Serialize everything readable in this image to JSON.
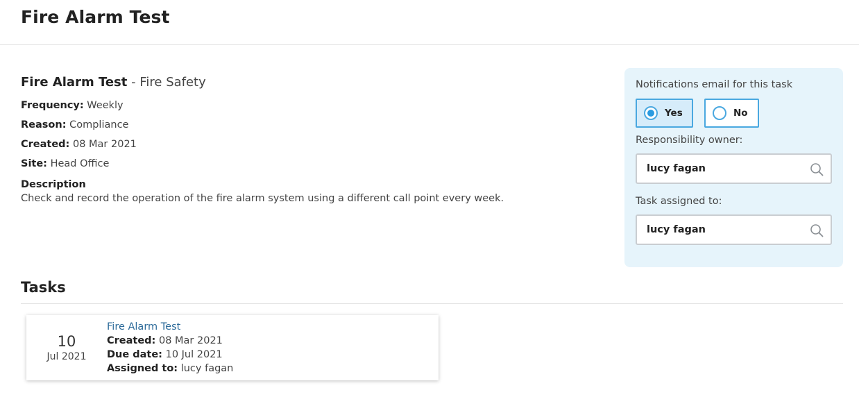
{
  "header": {
    "title": "Fire Alarm Test"
  },
  "details": {
    "name": "Fire Alarm Test",
    "separator": " - ",
    "category": "Fire Safety",
    "frequency_label": "Frequency:",
    "frequency": "Weekly",
    "reason_label": "Reason:",
    "reason": "Compliance",
    "created_label": "Created:",
    "created": "08 Mar 2021",
    "site_label": "Site:",
    "site": "Head Office",
    "description_label": "Description",
    "description": "Check and record the operation of the fire alarm system using a different call point every week."
  },
  "panel": {
    "notifications_label": "Notifications email for this task",
    "options": [
      {
        "label": "Yes",
        "selected": true
      },
      {
        "label": "No",
        "selected": false
      }
    ],
    "owner_label": "Responsibility owner:",
    "owner_value": "lucy fagan",
    "assigned_label": "Task assigned to:",
    "assigned_value": "lucy fagan",
    "accent_color": "#4aa8e0",
    "background_color": "#e6f4fb"
  },
  "tasks": {
    "heading": "Tasks",
    "items": [
      {
        "day": "10",
        "month_year": "Jul 2021",
        "title": "Fire Alarm Test",
        "created_label": "Created:",
        "created": "08 Mar 2021",
        "due_label": "Due date:",
        "due": "10 Jul 2021",
        "assigned_label": "Assigned to:",
        "assigned": "lucy fagan"
      }
    ]
  },
  "icons": {
    "search": "search-icon"
  }
}
